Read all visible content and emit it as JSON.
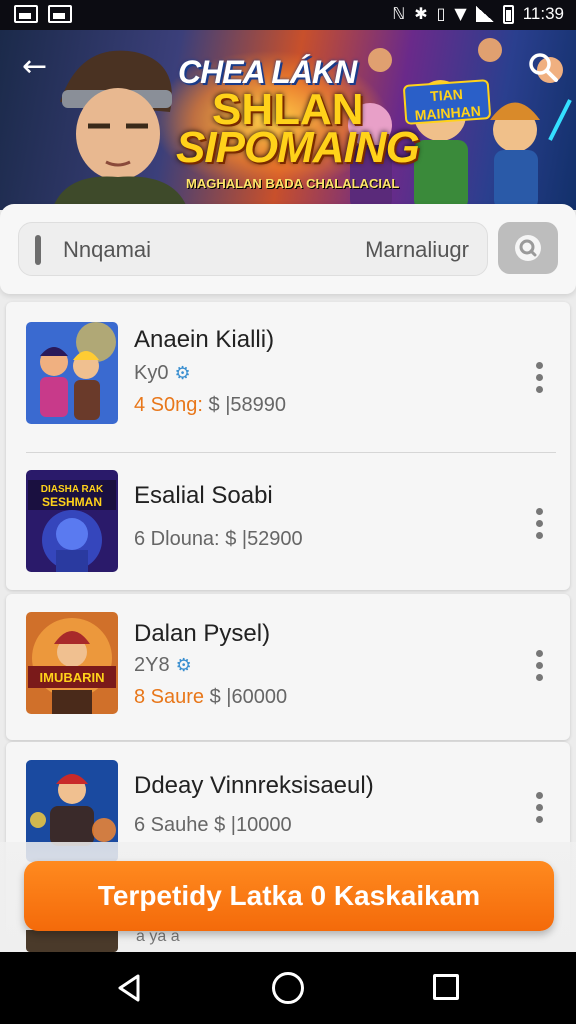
{
  "status_bar": {
    "time": "11:39",
    "icons": [
      "image-icon",
      "photo-icon",
      "nfc-icon",
      "bluetooth-icon",
      "vibrate-icon",
      "wifi-icon",
      "signal-icon",
      "battery-icon"
    ]
  },
  "banner": {
    "line1": "CHEA LÁKN",
    "line2": "SHLAN",
    "line3": "SIPOMAING",
    "line4": "MAGHALAN BADA CHALALACIAL",
    "logo_text": "TIAN MAINHAN",
    "back_icon": "arrow-left-icon",
    "search_icon": "search-icon"
  },
  "search": {
    "left_text": "Nnqamai",
    "right_text": "Marnaliugr",
    "button_icon": "search-icon"
  },
  "games": [
    {
      "title": "Anaein Kialli)",
      "sub": "Ky0",
      "count": "4 S0ng:",
      "price": "$ |58990",
      "thumb_text": ""
    },
    {
      "title": "Esalial Soabi",
      "sub": "",
      "count": "6 Dlouna:",
      "price": "$ |52900",
      "thumb_text": "DIASHA RAK SESHMAN"
    },
    {
      "title": "Dalan Pysel)",
      "sub": "2Y8",
      "count": "8 Saure",
      "price": "$ |60000",
      "thumb_text": "IMUBARIN"
    },
    {
      "title": "Ddeay Vinnreksisaeul)",
      "sub": "",
      "count": "6 Sauhe",
      "price": "$ |10000",
      "thumb_text": ""
    }
  ],
  "peek_row": {
    "text": "a ya a"
  },
  "cta": {
    "label": "Terpetidy Latka 0 Kaskaikam"
  },
  "nav": {
    "back_icon": "nav-back-icon",
    "home_icon": "nav-home-icon",
    "recent_icon": "nav-recents-icon"
  },
  "colors": {
    "accent": "#f57512",
    "status_bar": "#0c0c12",
    "nav_bar": "#000000",
    "gear": "#3a8fd0",
    "count": "#e8771a"
  }
}
